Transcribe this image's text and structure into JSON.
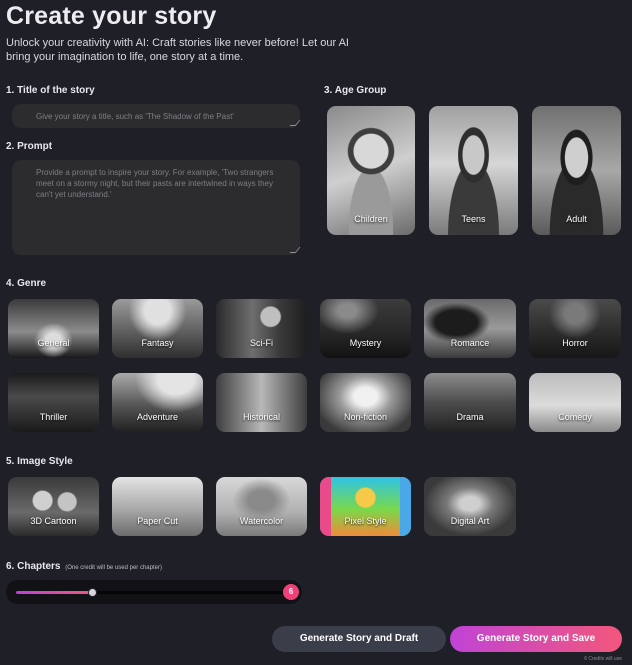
{
  "header": {
    "title": "Create your story",
    "subtitle": "Unlock your creativity with AI: Craft stories like never before! Let our AI bring your imagination to life, one story at a time."
  },
  "title_section": {
    "label": "1. Title of the story",
    "placeholder": "Give your story a title, such as 'The Shadow of the Past'"
  },
  "prompt_section": {
    "label": "2. Prompt",
    "placeholder": "Provide a prompt to inspire your story. For example, 'Two strangers meet on a stormy night, but their pasts are intertwined in ways they can't yet understand.'"
  },
  "age_section": {
    "label": "3. Age Group",
    "options": [
      {
        "label": "Children"
      },
      {
        "label": "Teens"
      },
      {
        "label": "Adult"
      }
    ]
  },
  "genre_section": {
    "label": "4. Genre",
    "options": [
      {
        "label": "General"
      },
      {
        "label": "Fantasy"
      },
      {
        "label": "Sci-Fi"
      },
      {
        "label": "Mystery"
      },
      {
        "label": "Romance"
      },
      {
        "label": "Horror"
      },
      {
        "label": "Thriller"
      },
      {
        "label": "Adventure"
      },
      {
        "label": "Historical"
      },
      {
        "label": "Non-fiction"
      },
      {
        "label": "Drama"
      },
      {
        "label": "Comedy"
      }
    ]
  },
  "style_section": {
    "label": "5. Image Style",
    "options": [
      {
        "label": "3D Cartoon"
      },
      {
        "label": "Paper Cut"
      },
      {
        "label": "Watercolor"
      },
      {
        "label": "Pixel Style"
      },
      {
        "label": "Digital Art"
      }
    ]
  },
  "chapters_section": {
    "label": "6. Chapters",
    "note": "(One credit will be used per chapter)",
    "value": "6",
    "slider_fraction": 0.28
  },
  "actions": {
    "draft_label": "Generate Story and Draft",
    "save_label": "Generate Story and Save",
    "credits_note": "6 Credits will use"
  },
  "colors": {
    "background": "#1f1f28",
    "accent_start": "#c043d6",
    "accent_end": "#f2577c"
  }
}
